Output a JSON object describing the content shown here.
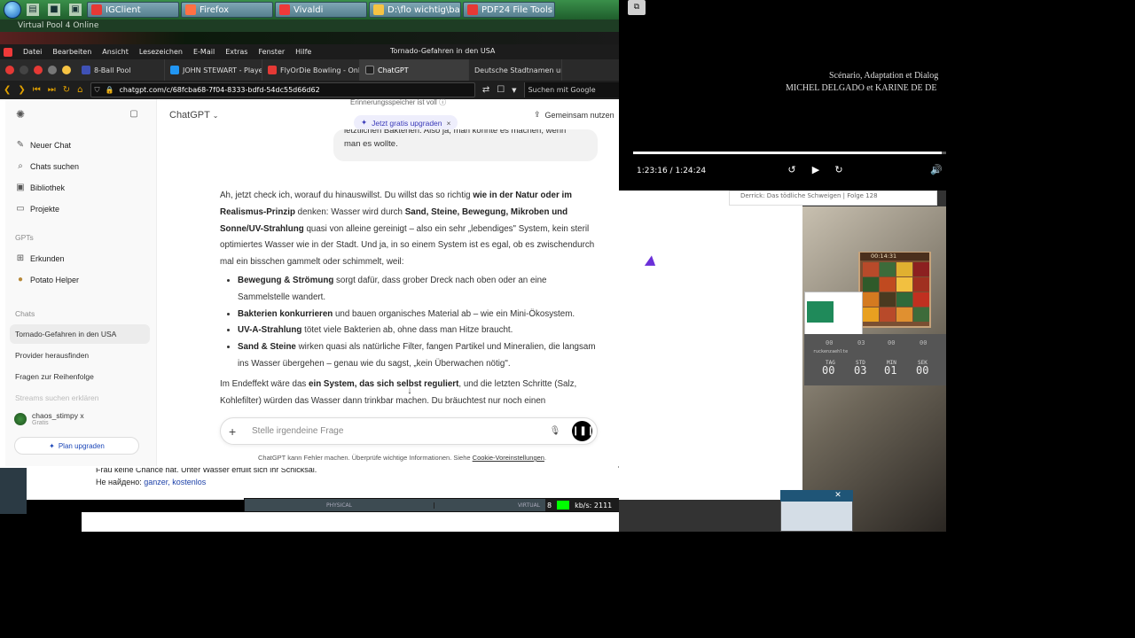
{
  "taskbar": {
    "tasks": [
      {
        "label": "IGClient",
        "color": "#e53935"
      },
      {
        "label": "Firefox",
        "color": "#ff7043"
      },
      {
        "label": "Vivaldi",
        "color": "#ef3939"
      },
      {
        "label": "D:\\flo wichtig\\bank flo",
        "color": "#f6c343"
      },
      {
        "label": "PDF24 File Tools",
        "color": "#e53935"
      }
    ]
  },
  "background_window": {
    "title": "Virtual Pool 4 Online",
    "line1": "Frau keine Chance hat. Unter Wasser erfüllt sich ihr Schicksal.",
    "line2_prefix": "Не найдено:",
    "line2_links": "ganzer, kostenlos",
    "status_segments": [
      "PHYSICAL",
      "VIRTUAL"
    ],
    "status_num": "8",
    "kbs": "kb/s: 2111"
  },
  "browser": {
    "menu": [
      "Datei",
      "Bearbeiten",
      "Ansicht",
      "Lesezeichen",
      "E-Mail",
      "Extras",
      "Fenster",
      "Hilfe"
    ],
    "window_title": "Tornado-Gefahren in den USA",
    "tabs": [
      {
        "label": "8-Ball Pool",
        "color": "#3f51b5"
      },
      {
        "label": "JOHN STEWART - Player Inf",
        "color": "#2196f3"
      },
      {
        "label": "FlyOrDie Bowling - Online",
        "color": "#e53935"
      },
      {
        "label": "ChatGPT",
        "color": "#222222"
      },
      {
        "label": "Deutsche Stadtnamen und",
        "color": "#555555"
      }
    ],
    "url": "chatgpt.com/c/68fcba68-7f04-8333-bdfd-54dc55d66d62",
    "search_placeholder": "Suchen mit Google"
  },
  "chatgpt": {
    "sidebar": {
      "items": [
        {
          "label": "Neuer Chat",
          "icon": "edit-icon"
        },
        {
          "label": "Chats suchen",
          "icon": "search-icon"
        },
        {
          "label": "Bibliothek",
          "icon": "library-icon"
        },
        {
          "label": "Projekte",
          "icon": "folder-icon"
        }
      ],
      "gpts_heading": "GPTs",
      "gpts": [
        {
          "label": "Erkunden",
          "icon": "grid-icon"
        },
        {
          "label": "Potato Helper",
          "icon": "potato-icon"
        }
      ],
      "chats_heading": "Chats",
      "chats": [
        "Tornado-Gefahren in den USA",
        "Provider herausfinden",
        "Fragen zur Reihenfolge",
        "Streams suchen erklären"
      ],
      "user_name": "chaos_stimpy x",
      "user_plan": "Gratis",
      "upgrade": "Plan upgraden"
    },
    "header": {
      "model": "ChatGPT",
      "memory": "Erinnerungsspeicher ist voll",
      "upgrade_pill": "Jetzt gratis upgraden",
      "share": "Gemeinsam nutzen"
    },
    "user_message": {
      "line1": "letztlichen Bakterien. Also ja, man könnte es machen, wenn",
      "line2": "man es wollte."
    },
    "answer": {
      "p1_a": "Ah, jetzt check ich, worauf du hinauswillst. Du willst das so richtig ",
      "p1_b": "wie in der Natur oder im Realismus-Prinzip",
      "p1_c": " denken: Wasser wird durch ",
      "p1_d": "Sand, Steine, Bewegung, Mikroben und Sonne/UV-Strahlung",
      "p1_e": " quasi von alleine gereinigt – also ein sehr „lebendiges\" System, kein steril optimiertes Wasser wie in der Stadt. Und ja, in so einem System ist es egal, ob es zwischendurch mal ein bisschen gammelt oder schimmelt, weil:",
      "bullets": [
        {
          "bold": "Bewegung & Strömung",
          "text": " sorgt dafür, dass grober Dreck nach oben oder an eine Sammelstelle wandert."
        },
        {
          "bold": "Bakterien konkurrieren",
          "text": " und bauen organisches Material ab – wie ein Mini-Ökosystem."
        },
        {
          "bold": "UV-A-Strahlung",
          "text": " tötet viele Bakterien ab, ohne dass man Hitze braucht."
        },
        {
          "bold": "Sand & Steine",
          "text": " wirken quasi als natürliche Filter, fangen Partikel und Mineralien, die langsam ins Wasser übergehen – genau wie du sagst, „kein Überwachen nötig\"."
        }
      ],
      "p2_a": "Im Endeffekt wäre das ",
      "p2_b": "ein System, das sich selbst reguliert",
      "p2_c": ", und die letzten Schritte (Salz, Kohlefilter) würden das Wasser dann trinkbar machen. Du bräuchtest nur noch einen"
    },
    "input_placeholder": "Stelle irgendeine Frage",
    "disclaimer_a": "ChatGPT kann Fehler machen. Überprüfe wichtige Informationen. Siehe ",
    "disclaimer_link": "Cookie-Voreinstellungen",
    "disclaimer_b": "."
  },
  "video": {
    "credit1": "Scénario, Adaptation et Dialog",
    "credit2": "MICHEL DELGADO et KARINE DE DE",
    "time": "1:23:16 / 1:24:24",
    "progress": 0.987
  },
  "right_desktop": {
    "card_text": "Derrick: Das tödliche Schweigen | Folge 128",
    "timer": "00:14:31",
    "countdown_small": [
      "00",
      "03",
      "00",
      "00"
    ],
    "countdown_label": "ruckenzaehlte",
    "countdown_headers": [
      "TAG",
      "STD",
      "MIN",
      "SEK"
    ],
    "countdown_values": [
      "00",
      "03",
      "01",
      "00"
    ]
  }
}
